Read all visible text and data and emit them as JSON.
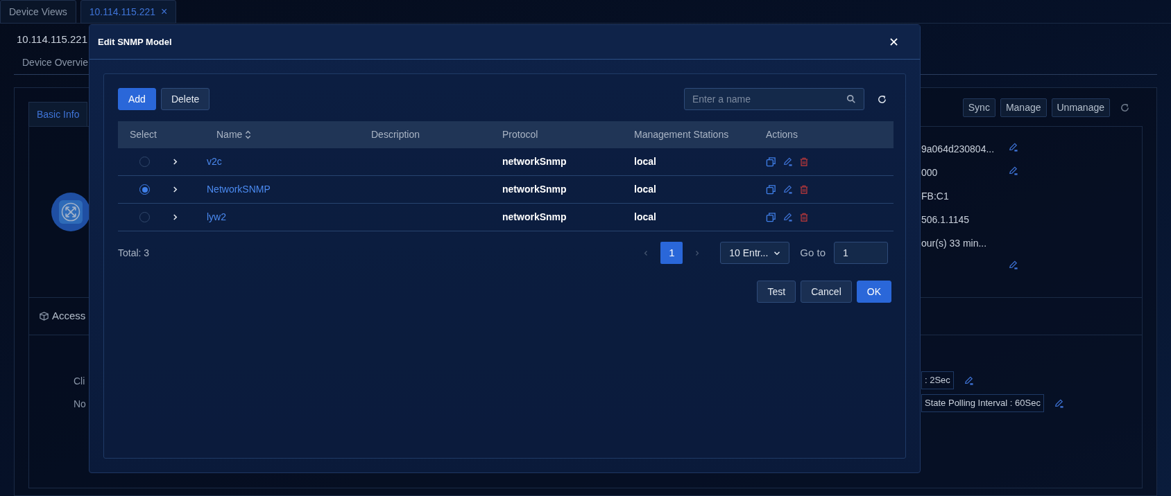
{
  "tabs": [
    {
      "label": "Device Views",
      "selected": false
    },
    {
      "label": "10.114.115.221",
      "selected": true,
      "close": "×"
    }
  ],
  "page": {
    "title": "10.114.115.221",
    "nav_tab": "Device Overvie",
    "card_tab": "Basic Info",
    "actions": [
      "Sync",
      "Manage",
      "Unmanage"
    ],
    "info_rows": [
      {
        "text": "9a064d230804...",
        "editable": true
      },
      {
        "text": "000",
        "editable": true
      },
      {
        "text": "FB:C1",
        "editable": false
      },
      {
        "text": "506.1.1145",
        "editable": false
      },
      {
        "text": "our(s) 33 min...",
        "editable": false
      },
      {
        "editable": true
      }
    ],
    "section": "Access",
    "labels": [
      "Cli",
      "No"
    ],
    "tags": [
      ": 2Sec",
      "State Polling Interval : 60Sec"
    ]
  },
  "modal": {
    "title": "Edit SNMP Model",
    "toolbar_buttons": [
      {
        "label": "Add",
        "kind": "primary"
      },
      {
        "label": "Delete",
        "kind": "default"
      }
    ],
    "search": {
      "placeholder": "Enter a name"
    },
    "table": {
      "columns": [
        {
          "label": "Select",
          "sortable": false
        },
        {
          "label": "Name",
          "sortable": true
        },
        {
          "label": "Description",
          "sortable": false
        },
        {
          "label": "Protocol",
          "sortable": false
        },
        {
          "label": "Management Stations",
          "sortable": false
        },
        {
          "label": "Actions",
          "sortable": false
        }
      ],
      "rows": [
        {
          "selected": false,
          "name": "v2c",
          "protocol": "networkSnmp",
          "stations": "local"
        },
        {
          "selected": true,
          "name": "NetworkSNMP",
          "protocol": "networkSnmp",
          "stations": "local"
        },
        {
          "selected": false,
          "name": "lyw2",
          "protocol": "networkSnmp",
          "stations": "local"
        }
      ]
    },
    "total": "Total: 3",
    "pagination": {
      "pages": [
        {
          "label": "1",
          "selected": true
        }
      ],
      "page_size": "10 Entr...",
      "goto_label": "Go to",
      "goto_value": "1"
    },
    "footer_buttons": [
      {
        "label": "Test",
        "kind": "default"
      },
      {
        "label": "Cancel",
        "kind": "default"
      },
      {
        "label": "OK",
        "kind": "primary"
      }
    ]
  }
}
